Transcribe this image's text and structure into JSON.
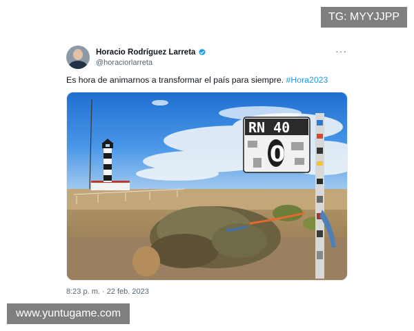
{
  "watermarks": {
    "top_right": "TG: MYYJJPP",
    "bottom_left": "www.yuntugame.com"
  },
  "tweet": {
    "author": {
      "display_name": "Horacio Rodríguez Larreta",
      "handle": "@horaciorlarreta",
      "verified": true,
      "avatar_icon": "user-avatar-photo"
    },
    "more_label": "···",
    "text": "Es hora de animarnos a transformar el país para siempre. ",
    "hashtag": "#Hora2023",
    "media": {
      "description_icons": [
        "lighthouse",
        "road-sign"
      ],
      "sign_route": "RN 40",
      "sign_km": "0"
    },
    "timestamp": "8:23 p. m. · 22 feb. 2023"
  },
  "colors": {
    "accent": "#1d9bf0",
    "secondary_text": "#536471",
    "primary_text": "#0f1419"
  }
}
